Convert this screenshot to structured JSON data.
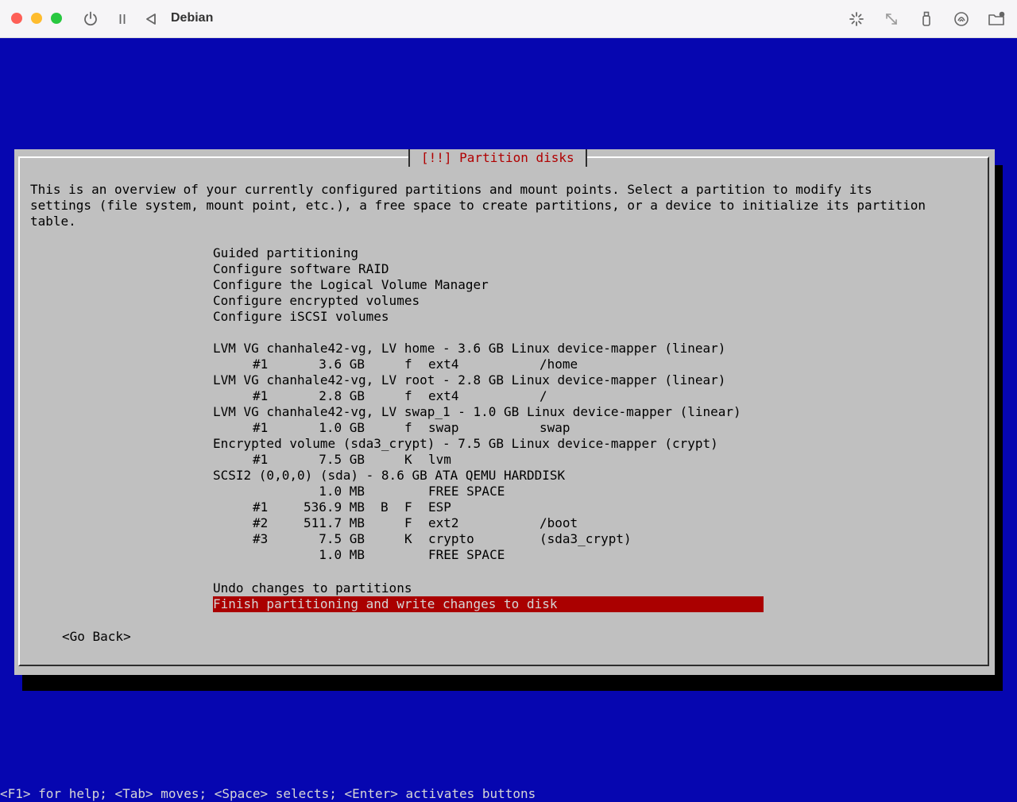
{
  "window": {
    "title": "Debian",
    "icons": [
      "power-icon",
      "pause-icon",
      "back-icon",
      "brightness-icon",
      "resize-icon",
      "usb-icon",
      "audio-icon",
      "folder-icon"
    ]
  },
  "dialog": {
    "title": "[!!] Partition disks",
    "intro": [
      "This is an overview of your currently configured partitions and mount points. Select a partition to modify its",
      "settings (file system, mount point, etc.), a free space to create partitions, or a device to initialize its partition",
      "table."
    ],
    "options": [
      "Guided partitioning",
      "Configure software RAID",
      "Configure the Logical Volume Manager",
      "Configure encrypted volumes",
      "Configure iSCSI volumes"
    ],
    "devices": [
      {
        "header": "LVM VG chanhale42-vg, LV home - 3.6 GB Linux device-mapper (linear)",
        "partitions": [
          {
            "num": "#1",
            "size": "3.6 GB",
            "flag1": "",
            "flag2": "f",
            "fs": "ext4",
            "mount": "/home"
          }
        ]
      },
      {
        "header": "LVM VG chanhale42-vg, LV root - 2.8 GB Linux device-mapper (linear)",
        "partitions": [
          {
            "num": "#1",
            "size": "2.8 GB",
            "flag1": "",
            "flag2": "f",
            "fs": "ext4",
            "mount": "/"
          }
        ]
      },
      {
        "header": "LVM VG chanhale42-vg, LV swap_1 - 1.0 GB Linux device-mapper (linear)",
        "partitions": [
          {
            "num": "#1",
            "size": "1.0 GB",
            "flag1": "",
            "flag2": "f",
            "fs": "swap",
            "mount": "swap"
          }
        ]
      },
      {
        "header": "Encrypted volume (sda3_crypt) - 7.5 GB Linux device-mapper (crypt)",
        "partitions": [
          {
            "num": "#1",
            "size": "7.5 GB",
            "flag1": "",
            "flag2": "K",
            "fs": "lvm",
            "mount": ""
          }
        ]
      },
      {
        "header": "SCSI2 (0,0,0) (sda) - 8.6 GB ATA QEMU HARDDISK",
        "partitions": [
          {
            "num": "",
            "size": "1.0 MB",
            "flag1": "",
            "flag2": "",
            "fs": "FREE SPACE",
            "mount": ""
          },
          {
            "num": "#1",
            "size": "536.9 MB",
            "flag1": "B",
            "flag2": "F",
            "fs": "ESP",
            "mount": ""
          },
          {
            "num": "#2",
            "size": "511.7 MB",
            "flag1": "",
            "flag2": "F",
            "fs": "ext2",
            "mount": "/boot"
          },
          {
            "num": "#3",
            "size": "7.5 GB",
            "flag1": "",
            "flag2": "K",
            "fs": "crypto",
            "mount": "(sda3_crypt)"
          },
          {
            "num": "",
            "size": "1.0 MB",
            "flag1": "",
            "flag2": "",
            "fs": "FREE SPACE",
            "mount": ""
          }
        ]
      }
    ],
    "undo": "Undo changes to partitions",
    "finish": "Finish partitioning and write changes to disk",
    "go_back": "<Go Back>"
  },
  "status_bar": "<F1> for help; <Tab> moves; <Space> selects; <Enter> activates buttons"
}
